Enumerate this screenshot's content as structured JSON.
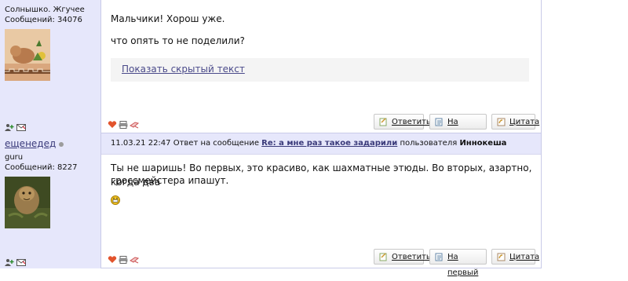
{
  "posts": [
    {
      "author": {
        "nick": "",
        "status": "Солнышко. Жгучее",
        "count": "Сообщений: 34076"
      },
      "body": [
        "Мальчики! Хорош уже.",
        "что опять то не поделили?"
      ],
      "spoiler": "Показать скрытый текст",
      "buttons": {
        "reply": "Ответить",
        "first": "На первый",
        "quote": "Цитата"
      }
    },
    {
      "author": {
        "nick": "ещенедед",
        "status": "guru",
        "count": "Сообщений: 8227"
      },
      "header": {
        "timestamp": "11.03.21 22:47",
        "reply_prefix": "Ответ на сообщение",
        "reply_link": "Re: а мне раз такое задарили",
        "user_prefix": "пользователя",
        "user": "Иннокеша"
      },
      "body": [
        "Ты не шаришь! Во первых, это красиво, как шахматные этюды. Во вторых, азартно, когда два",
        "гроссмейстера ипашут."
      ],
      "buttons": {
        "reply": "Ответить",
        "first": "На первый",
        "quote": "Цитата"
      }
    }
  ],
  "colors": {
    "sidebar": "#e6e7fb",
    "link": "#3a3a7a",
    "border": "#c9cbe8"
  }
}
